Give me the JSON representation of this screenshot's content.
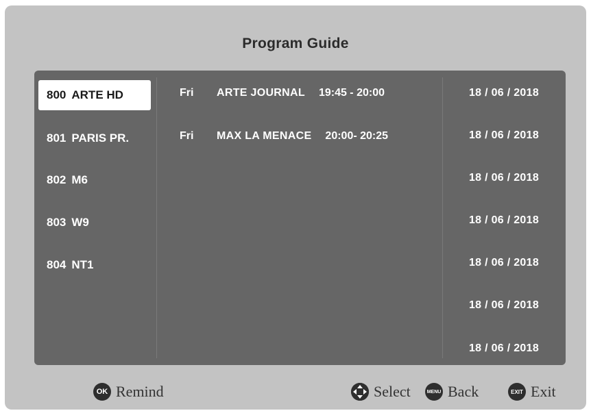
{
  "title": "Program Guide",
  "channels": [
    {
      "number": "800",
      "name": "ARTE HD",
      "selected": true
    },
    {
      "number": "801",
      "name": "PARIS PR.",
      "selected": false
    },
    {
      "number": "802",
      "name": "M6",
      "selected": false
    },
    {
      "number": "803",
      "name": "W9",
      "selected": false
    },
    {
      "number": "804",
      "name": "NT1",
      "selected": false
    }
  ],
  "events": [
    {
      "day": "Fri",
      "name": "ARTE JOURNAL",
      "time": "19:45 - 20:00"
    },
    {
      "day": "Fri",
      "name": "MAX LA MENACE",
      "time": "20:00- 20:25"
    }
  ],
  "dates": [
    "18 / 06 / 2018",
    "18 / 06 / 2018",
    "18 / 06 / 2018",
    "18 / 06 / 2018",
    "18 / 06 / 2018",
    "18 / 06 / 2018",
    "18 / 06 / 2018"
  ],
  "footer": {
    "ok_key": "OK",
    "remind_label": "Remind",
    "select_label": "Select",
    "menu_key": "MENU",
    "back_label": "Back",
    "exit_key": "EXIT",
    "exit_label": "Exit"
  },
  "colors": {
    "frame": "#c3c3c3",
    "panel": "#666666",
    "highlight": "#ffffff",
    "key": "#2e2e2e"
  }
}
